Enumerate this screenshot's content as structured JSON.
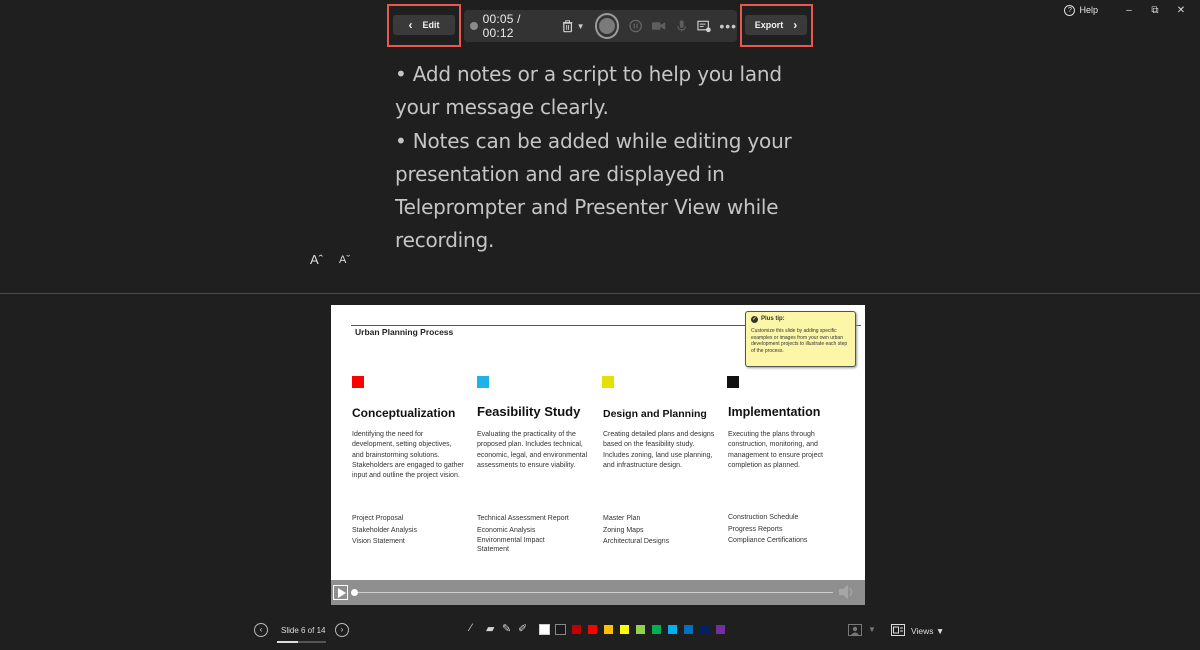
{
  "window": {
    "help_label": "Help",
    "minimize_glyph": "–",
    "restore_glyph": "⧉",
    "close_glyph": "✕"
  },
  "toolbar": {
    "edit_label": "Edit",
    "export_label": "Export",
    "back_glyph": "‹",
    "forward_glyph": "›",
    "timer": "00:05 / 00:12",
    "icons": [
      "record-dot-icon",
      "trash-icon",
      "chevron-down-icon",
      "record-button",
      "pause-icon",
      "camera-icon",
      "microphone-icon",
      "view-options-icon",
      "more-icon"
    ],
    "highlight_color": "#e8584e"
  },
  "teleprompter": {
    "text": "• Add notes or a script to help you land your message clearly.\n• Notes can be added while editing your presentation and are displayed in Teleprompter and Presenter View while recording.",
    "increase_font": "Aˆ",
    "decrease_font": "Aˇ"
  },
  "slide": {
    "title": "Urban Planning Process",
    "tip": {
      "heading": "Plus tip:",
      "text": "Customize this slide by adding specific examples or images from your own urban development projects to illustrate each step of the process."
    },
    "columns": [
      {
        "color": "#ff0000",
        "heading": "Conceptualization",
        "description": "Identifying the need for development, setting objectives, and brainstorming solutions. Stakeholders are engaged to gather input and outline the project vision.",
        "deliverables": [
          "Project Proposal",
          "Stakeholder Analysis",
          "Vision Statement"
        ]
      },
      {
        "color": "#1fb1ea",
        "heading": "Feasibility Study",
        "description": "Evaluating the practicality of the proposed plan. Includes technical, economic, legal, and environmental assessments to ensure viability.",
        "deliverables": [
          "Technical Assessment Report",
          "Economic Analysis",
          "Environmental Impact Statement"
        ]
      },
      {
        "color": "#e8e000",
        "heading": "Design and Planning",
        "description": "Creating detailed plans and designs based on the feasibility study. Includes zoning, land use planning, and infrastructure design.",
        "deliverables": [
          "Master Plan",
          "Zoning Maps",
          "Architectural Designs"
        ]
      },
      {
        "color": "#111111",
        "heading": "Implementation",
        "description": "Executing the plans through construction, monitoring, and management to ensure project completion as planned.",
        "deliverables": [
          "Construction Schedule",
          "Progress Reports",
          "Compliance Certifications"
        ]
      }
    ],
    "playback_progress": 0.0
  },
  "bottom": {
    "slide_counter": "Slide 6 of 14",
    "views_label": "Views",
    "prev_glyph": "‹",
    "next_glyph": "›",
    "slide_progress": 0.43,
    "swatches": [
      "#ffffff",
      "#1a1a1a",
      "#c00000",
      "#ff0000",
      "#ffc000",
      "#ffff00",
      "#92d050",
      "#00b050",
      "#00b0f0",
      "#0070c0",
      "#002060",
      "#7030a0"
    ]
  }
}
